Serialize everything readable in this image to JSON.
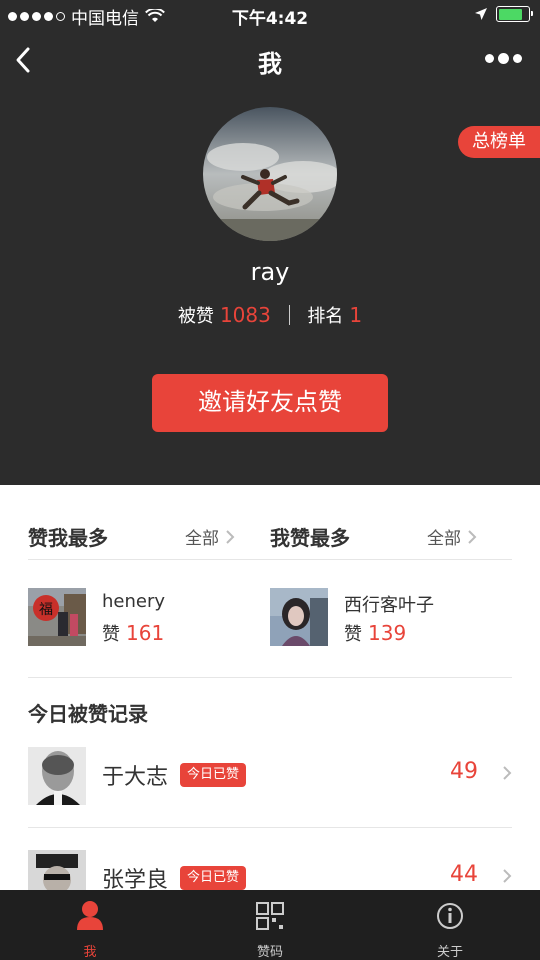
{
  "status_bar": {
    "carrier": "中国电信",
    "time": "下午4:42"
  },
  "header": {
    "title": "我",
    "ranking_tag": "总榜单",
    "username": "ray",
    "likes_label": "被赞",
    "likes_count": "1083",
    "rank_label": "排名",
    "rank_value": "1",
    "invite_button": "邀请好友点赞"
  },
  "most_liked_me": {
    "title": "赞我最多",
    "all_label": "全部",
    "user": {
      "name": "henery",
      "likes_label": "赞",
      "likes": "161"
    }
  },
  "i_liked_most": {
    "title": "我赞最多",
    "all_label": "全部",
    "user": {
      "name": "西行客叶子",
      "likes_label": "赞",
      "likes": "139"
    }
  },
  "today_records": {
    "title": "今日被赞记录",
    "items": [
      {
        "name": "于大志",
        "badge": "今日已赞",
        "count": "49"
      },
      {
        "name": "张学良",
        "badge": "今日已赞",
        "count": "44"
      }
    ]
  },
  "tab_bar": {
    "tabs": [
      {
        "label": "我",
        "icon": "user-icon",
        "active": true
      },
      {
        "label": "赞码",
        "icon": "qrcode-icon",
        "active": false
      },
      {
        "label": "关于",
        "icon": "info-icon",
        "active": false
      }
    ]
  },
  "colors": {
    "accent": "#e8443a",
    "header_bg": "#2c2c2c",
    "tab_bar_bg": "#1f1f1f"
  }
}
